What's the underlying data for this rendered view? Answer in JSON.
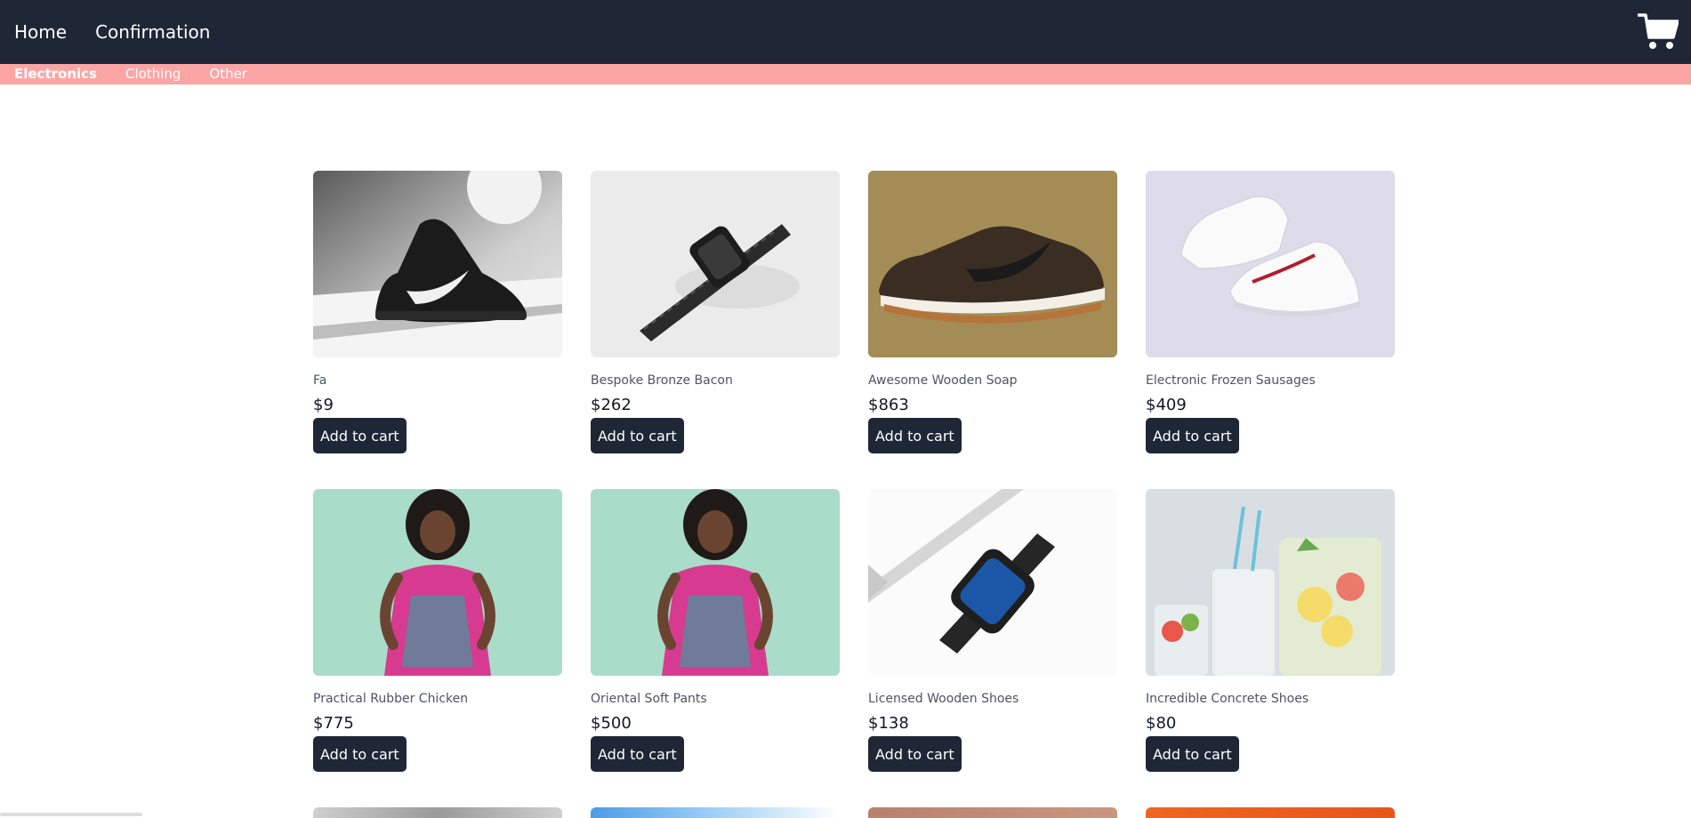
{
  "header": {
    "nav": [
      {
        "label": "Home"
      },
      {
        "label": "Confirmation"
      }
    ],
    "cart_icon": "cart-icon"
  },
  "categories": [
    {
      "label": "Electronics",
      "active": true
    },
    {
      "label": "Clothing",
      "active": false
    },
    {
      "label": "Other",
      "active": false
    }
  ],
  "products": [
    {
      "name": "Fa",
      "price": "$9",
      "button": "Add to cart",
      "image": "black-sneaker-photo"
    },
    {
      "name": "Bespoke Bronze Bacon",
      "price": "$262",
      "button": "Add to cart",
      "image": "metal-watch-photo"
    },
    {
      "name": "Awesome Wooden Soap",
      "price": "$863",
      "button": "Add to cart",
      "image": "brown-sneaker-photo"
    },
    {
      "name": "Electronic Frozen Sausages",
      "price": "$409",
      "button": "Add to cart",
      "image": "white-sneakers-photo"
    },
    {
      "name": "Practical Rubber Chicken",
      "price": "$775",
      "button": "Add to cart",
      "image": "woman-dress-photo"
    },
    {
      "name": "Oriental Soft Pants",
      "price": "$500",
      "button": "Add to cart",
      "image": "woman-dress-photo"
    },
    {
      "name": "Licensed Wooden Shoes",
      "price": "$138",
      "button": "Add to cart",
      "image": "smartwatch-photo"
    },
    {
      "name": "Incredible Concrete Shoes",
      "price": "$80",
      "button": "Add to cart",
      "image": "drinks-photo"
    }
  ],
  "colors": {
    "header_bg": "#1f2736",
    "category_bar_bg": "#fca5a5",
    "button_bg": "#1f2736"
  }
}
